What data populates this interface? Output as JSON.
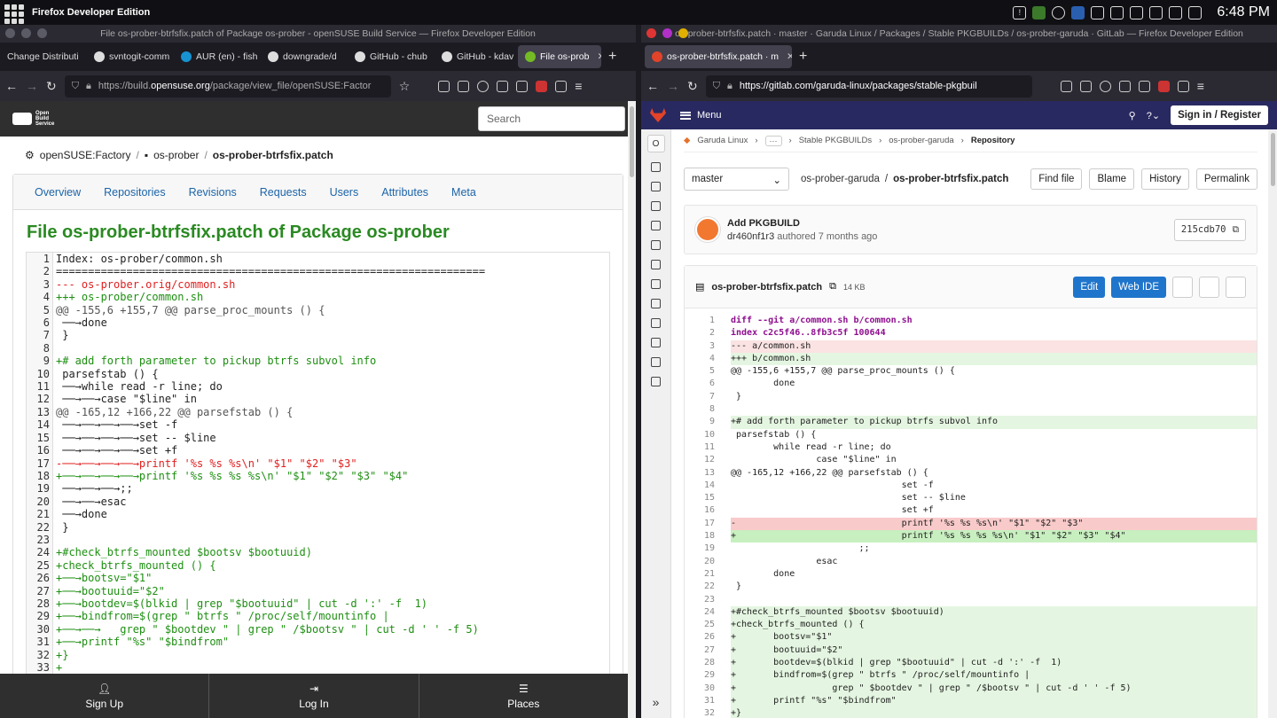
{
  "system": {
    "app_name": "Firefox Developer Edition",
    "clock": "6:48 PM"
  },
  "left": {
    "window_title": "File os-prober-btrfsfix.patch of Package os-prober - openSUSE Build Service — Firefox Developer Edition",
    "tabs": [
      {
        "label": "Change Distributi"
      },
      {
        "label": "svntogit-comm"
      },
      {
        "label": "AUR (en) - fish"
      },
      {
        "label": "downgrade/d"
      },
      {
        "label": "GitHub - chub"
      },
      {
        "label": "GitHub - kdav"
      },
      {
        "label": "File os-prob"
      }
    ],
    "url_prefix": "https://build.",
    "url_domain": "opensuse.org",
    "url_suffix": "/package/view_file/openSUSE:Factor",
    "logo_text": "Open Build Service",
    "search_placeholder": "Search",
    "breadcrumbs": [
      "openSUSE:Factory",
      "os-prober",
      "os-prober-btrfsfix.patch"
    ],
    "nav_tabs": [
      "Overview",
      "Repositories",
      "Revisions",
      "Requests",
      "Users",
      "Attributes",
      "Meta"
    ],
    "page_title": "File os-prober-btrfsfix.patch of Package os-prober",
    "code_lines": [
      {
        "n": "1",
        "t": "Index: os-prober/common.sh",
        "k": "meta"
      },
      {
        "n": "2",
        "t": "===================================================================",
        "k": "meta"
      },
      {
        "n": "3",
        "t": "--- os-prober.orig/common.sh",
        "k": "del"
      },
      {
        "n": "4",
        "t": "+++ os-prober/common.sh",
        "k": "add"
      },
      {
        "n": "5",
        "t": "@@ -155,6 +155,7 @@ parse_proc_mounts () {",
        "k": "hunk"
      },
      {
        "n": "6",
        "t": " ──→done",
        "k": "ctx"
      },
      {
        "n": "7",
        "t": " }",
        "k": "ctx"
      },
      {
        "n": "8",
        "t": "",
        "k": "ctx"
      },
      {
        "n": "9",
        "t": "+# add forth parameter to pickup btrfs subvol info",
        "k": "add"
      },
      {
        "n": "10",
        "t": " parsefstab () {",
        "k": "ctx"
      },
      {
        "n": "11",
        "t": " ──→while read -r line; do",
        "k": "ctx"
      },
      {
        "n": "12",
        "t": " ──→──→case \"$line\" in",
        "k": "ctx"
      },
      {
        "n": "13",
        "t": "@@ -165,12 +166,22 @@ parsefstab () {",
        "k": "hunk"
      },
      {
        "n": "14",
        "t": " ──→──→──→──→set -f",
        "k": "ctx"
      },
      {
        "n": "15",
        "t": " ──→──→──→──→set -- $line",
        "k": "ctx"
      },
      {
        "n": "16",
        "t": " ──→──→──→──→set +f",
        "k": "ctx"
      },
      {
        "n": "17",
        "t": "-──→──→──→──→printf '%s %s %s\\n' \"$1\" \"$2\" \"$3\"",
        "k": "del"
      },
      {
        "n": "18",
        "t": "+──→──→──→──→printf '%s %s %s %s\\n' \"$1\" \"$2\" \"$3\" \"$4\"",
        "k": "add"
      },
      {
        "n": "19",
        "t": " ──→──→──→;;",
        "k": "ctx"
      },
      {
        "n": "20",
        "t": " ──→──→esac",
        "k": "ctx"
      },
      {
        "n": "21",
        "t": " ──→done",
        "k": "ctx"
      },
      {
        "n": "22",
        "t": " }",
        "k": "ctx"
      },
      {
        "n": "23",
        "t": "",
        "k": "ctx"
      },
      {
        "n": "24",
        "t": "+#check_btrfs_mounted $bootsv $bootuuid)",
        "k": "add"
      },
      {
        "n": "25",
        "t": "+check_btrfs_mounted () {",
        "k": "add"
      },
      {
        "n": "26",
        "t": "+──→bootsv=\"$1\"",
        "k": "add"
      },
      {
        "n": "27",
        "t": "+──→bootuuid=\"$2\"",
        "k": "add"
      },
      {
        "n": "28",
        "t": "+──→bootdev=$(blkid | grep \"$bootuuid\" | cut -d ':' -f  1)",
        "k": "add"
      },
      {
        "n": "29",
        "t": "+──→bindfrom=$(grep \" btrfs \" /proc/self/mountinfo |",
        "k": "add"
      },
      {
        "n": "30",
        "t": "+──→──→   grep \" $bootdev \" | grep \" /$bootsv \" | cut -d ' ' -f 5)",
        "k": "add"
      },
      {
        "n": "31",
        "t": "+──→printf \"%s\" \"$bindfrom\"",
        "k": "add"
      },
      {
        "n": "32",
        "t": "+}",
        "k": "add"
      },
      {
        "n": "33",
        "t": "+",
        "k": "add"
      }
    ],
    "footer": [
      {
        "label": "Sign Up"
      },
      {
        "label": "Log In"
      },
      {
        "label": "Places"
      }
    ]
  },
  "right": {
    "window_title": "os-prober-btrfsfix.patch · master · Garuda Linux / Packages / Stable PKGBUILDs / os-prober-garuda · GitLab — Firefox Developer Edition",
    "tab_label": "os-prober-btrfsfix.patch · m",
    "url": "https://gitlab.com/garuda-linux/packages/stable-pkgbuil",
    "menu_label": "Menu",
    "sign_in_label": "Sign in / Register",
    "project_letter": "O",
    "breadcrumbs": [
      "Garuda Linux",
      "···",
      "Stable PKGBUILDs",
      "os-prober-garuda",
      "Repository"
    ],
    "branch": "master",
    "path_root": "os-prober-garuda",
    "path_file": "os-prober-btrfsfix.patch",
    "file_buttons": [
      "Find file",
      "Blame",
      "History",
      "Permalink"
    ],
    "commit_title": "Add PKGBUILD",
    "commit_author": "dr460nf1r3",
    "commit_meta": "authored 7 months ago",
    "commit_sha": "215cdb70",
    "file_name": "os-prober-btrfsfix.patch",
    "file_size": "14 KB",
    "edit_label": "Edit",
    "webide_label": "Web IDE",
    "code_lines": [
      {
        "n": "1",
        "t": "diff --git a/common.sh b/common.sh",
        "k": "meta"
      },
      {
        "n": "2",
        "t": "index c2c5f46..8fb3c5f 100644",
        "k": "meta"
      },
      {
        "n": "3",
        "t": "--- a/common.sh",
        "k": "del"
      },
      {
        "n": "4",
        "t": "+++ b/common.sh",
        "k": "add"
      },
      {
        "n": "5",
        "t": "@@ -155,6 +155,7 @@ parse_proc_mounts () {",
        "k": "hunk"
      },
      {
        "n": "6",
        "t": "        done",
        "k": "ctx"
      },
      {
        "n": "7",
        "t": " }",
        "k": "ctx"
      },
      {
        "n": "8",
        "t": "",
        "k": "ctx"
      },
      {
        "n": "9",
        "t": "+# add forth parameter to pickup btrfs subvol info",
        "k": "add"
      },
      {
        "n": "10",
        "t": " parsefstab () {",
        "k": "ctx"
      },
      {
        "n": "11",
        "t": "        while read -r line; do",
        "k": "ctx"
      },
      {
        "n": "12",
        "t": "                case \"$line\" in",
        "k": "ctx"
      },
      {
        "n": "13",
        "t": "@@ -165,12 +166,22 @@ parsefstab () {",
        "k": "hunk"
      },
      {
        "n": "14",
        "t": "                                set -f",
        "k": "ctx"
      },
      {
        "n": "15",
        "t": "                                set -- $line",
        "k": "ctx"
      },
      {
        "n": "16",
        "t": "                                set +f",
        "k": "ctx"
      },
      {
        "n": "17",
        "t": "-                               printf '%s %s %s\\n' \"$1\" \"$2\" \"$3\"",
        "k": "del2"
      },
      {
        "n": "18",
        "t": "+                               printf '%s %s %s %s\\n' \"$1\" \"$2\" \"$3\" \"$4\"",
        "k": "add2"
      },
      {
        "n": "19",
        "t": "                        ;;",
        "k": "ctx"
      },
      {
        "n": "20",
        "t": "                esac",
        "k": "ctx"
      },
      {
        "n": "21",
        "t": "        done",
        "k": "ctx"
      },
      {
        "n": "22",
        "t": " }",
        "k": "ctx"
      },
      {
        "n": "23",
        "t": "",
        "k": "ctx"
      },
      {
        "n": "24",
        "t": "+#check_btrfs_mounted $bootsv $bootuuid)",
        "k": "add"
      },
      {
        "n": "25",
        "t": "+check_btrfs_mounted () {",
        "k": "add"
      },
      {
        "n": "26",
        "t": "+       bootsv=\"$1\"",
        "k": "add"
      },
      {
        "n": "27",
        "t": "+       bootuuid=\"$2\"",
        "k": "add"
      },
      {
        "n": "28",
        "t": "+       bootdev=$(blkid | grep \"$bootuuid\" | cut -d ':' -f  1)",
        "k": "add"
      },
      {
        "n": "29",
        "t": "+       bindfrom=$(grep \" btrfs \" /proc/self/mountinfo |",
        "k": "add"
      },
      {
        "n": "30",
        "t": "+                  grep \" $bootdev \" | grep \" /$bootsv \" | cut -d ' ' -f 5)",
        "k": "add"
      },
      {
        "n": "31",
        "t": "+       printf \"%s\" \"$bindfrom\"",
        "k": "add"
      },
      {
        "n": "32",
        "t": "+}",
        "k": "add"
      }
    ]
  },
  "colors": {
    "obs_green": "#2a8a22",
    "gitlab_nav": "#292961",
    "gitlab_blue": "#1f75cb",
    "diff_add_bg": "#e4f6e1",
    "diff_del_bg": "#fbe3e3"
  }
}
